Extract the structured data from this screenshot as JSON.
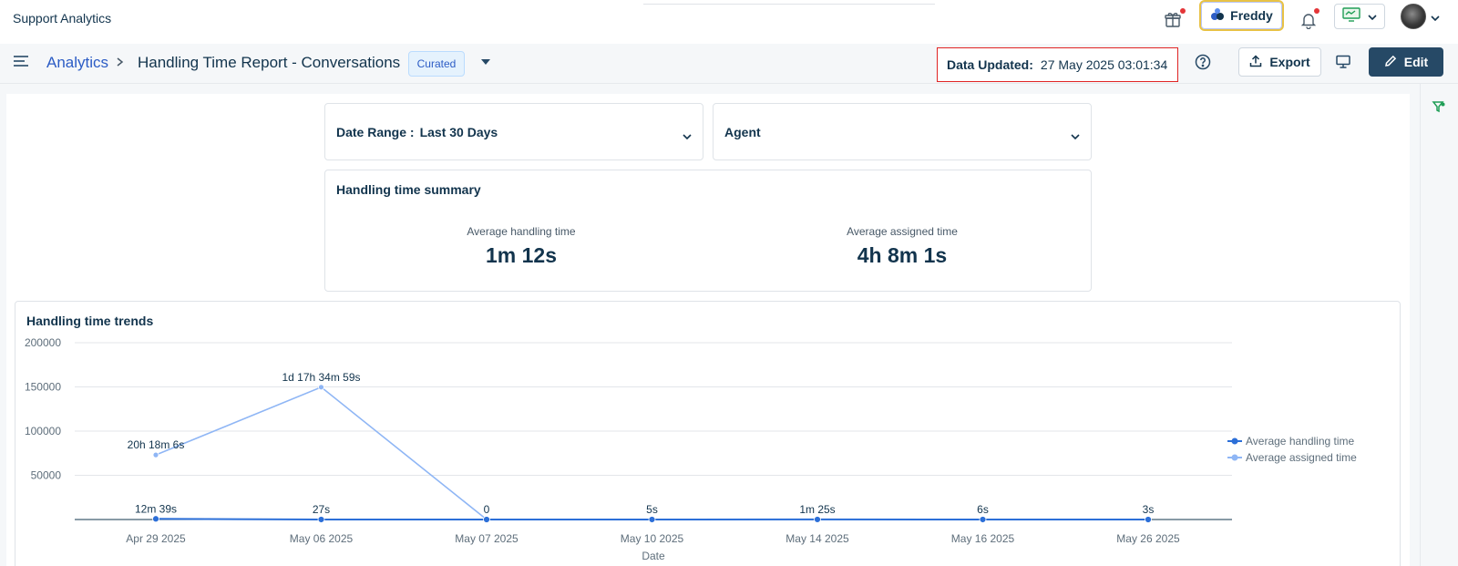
{
  "app": {
    "title": "Support Analytics"
  },
  "topbar": {
    "freddy_label": "Freddy"
  },
  "header": {
    "breadcrumb_root": "Analytics",
    "page_title": "Handling Time Report - Conversations",
    "badge": "Curated",
    "data_updated_label": "Data Updated:",
    "data_updated_value": "27 May 2025 03:01:34",
    "export_label": "Export",
    "edit_label": "Edit"
  },
  "filters": {
    "date_range_label": "Date Range :",
    "date_range_value": "Last 30 Days",
    "agent_label": "Agent"
  },
  "summary": {
    "title": "Handling time summary",
    "avg_handling_label": "Average handling time",
    "avg_handling_value": "1m 12s",
    "avg_assigned_label": "Average assigned time",
    "avg_assigned_value": "4h 8m 1s"
  },
  "trends": {
    "title": "Handling time trends"
  },
  "colors": {
    "brand": "#2c5cc5",
    "dark": "#264966",
    "handling": "#2c6fd8",
    "assigned": "#8fb6f5",
    "highlight": "#e02424"
  },
  "chart_data": {
    "type": "line",
    "title": "Handling time trends",
    "xlabel": "Date",
    "ylabel": "",
    "categories": [
      "Apr 29 2025",
      "May 06 2025",
      "May 07 2025",
      "May 10 2025",
      "May 14 2025",
      "May 16 2025",
      "May 26 2025"
    ],
    "yticks": [
      50000,
      100000,
      150000,
      200000
    ],
    "ylim": [
      0,
      200000
    ],
    "grid": true,
    "legend": "right",
    "series": [
      {
        "name": "Average handling time",
        "color": "#2c6fd8",
        "values": [
          759,
          27,
          0,
          5,
          85,
          6,
          3
        ],
        "labels": [
          "12m 39s",
          "27s",
          "0",
          "5s",
          "1m 25s",
          "6s",
          "3s"
        ]
      },
      {
        "name": "Average assigned time",
        "color": "#8fb6f5",
        "values": [
          73086,
          149699,
          0,
          0,
          0,
          0,
          0
        ],
        "labels": [
          "20h 18m 6s",
          "1d 17h 34m 59s",
          "",
          "",
          "",
          "",
          ""
        ]
      }
    ]
  }
}
